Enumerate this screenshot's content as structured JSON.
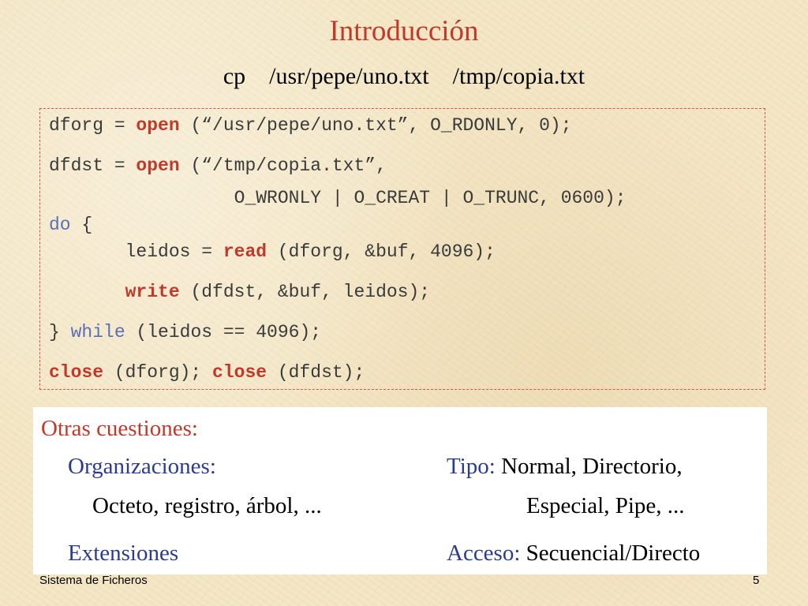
{
  "slide": {
    "title": "Introducción",
    "command": {
      "cmd": "cp",
      "src": "/usr/pepe/uno.txt",
      "dst": "/tmp/copia.txt"
    }
  },
  "code": {
    "line1": {
      "a": "dforg = ",
      "kw": "open",
      "b": " (“/usr/pepe/uno.txt”, O_RDONLY, 0);"
    },
    "line2": {
      "a": "dfdst = ",
      "kw": "open",
      "b": " (“/tmp/copia.txt”,"
    },
    "line3": {
      "a": "                 O_WRONLY | O_CREAT | O_TRUNC, 0600);"
    },
    "line4": {
      "kw": "do",
      "b": " {"
    },
    "line5": {
      "a": "       leidos = ",
      "kw": "read",
      "b": " (dforg, &buf, 4096);"
    },
    "line6": {
      "a": "       ",
      "kw": "write",
      "b": " (dfdst, &buf, leidos);"
    },
    "line7": {
      "a": "} ",
      "kw": "while",
      "b": " (leidos == 4096);"
    },
    "line8": {
      "kw1": "close",
      "b": " (dforg); ",
      "kw2": "close",
      "c": " (dfdst);"
    }
  },
  "info": {
    "heading": "Otras cuestiones:",
    "organizaciones_label": "Organizaciones:",
    "organizaciones_value": "Octeto, registro, árbol, ...",
    "extensiones_label": "Extensiones",
    "tipo_label": "Tipo:",
    "tipo_value_1": " Normal, Directorio,",
    "tipo_value_2": "Especial, Pipe, ...",
    "acceso_label": "Acceso:",
    "acceso_value": " Secuencial/Directo"
  },
  "footer": {
    "left": "Sistema de Ficheros",
    "page_number": "5"
  },
  "colors": {
    "title_red": "#c0392b",
    "keyword_red": "#c0392b",
    "keyword_blue": "#5b6fb5",
    "label_blue": "#2c3c8c",
    "background": "#f4e7c6"
  }
}
